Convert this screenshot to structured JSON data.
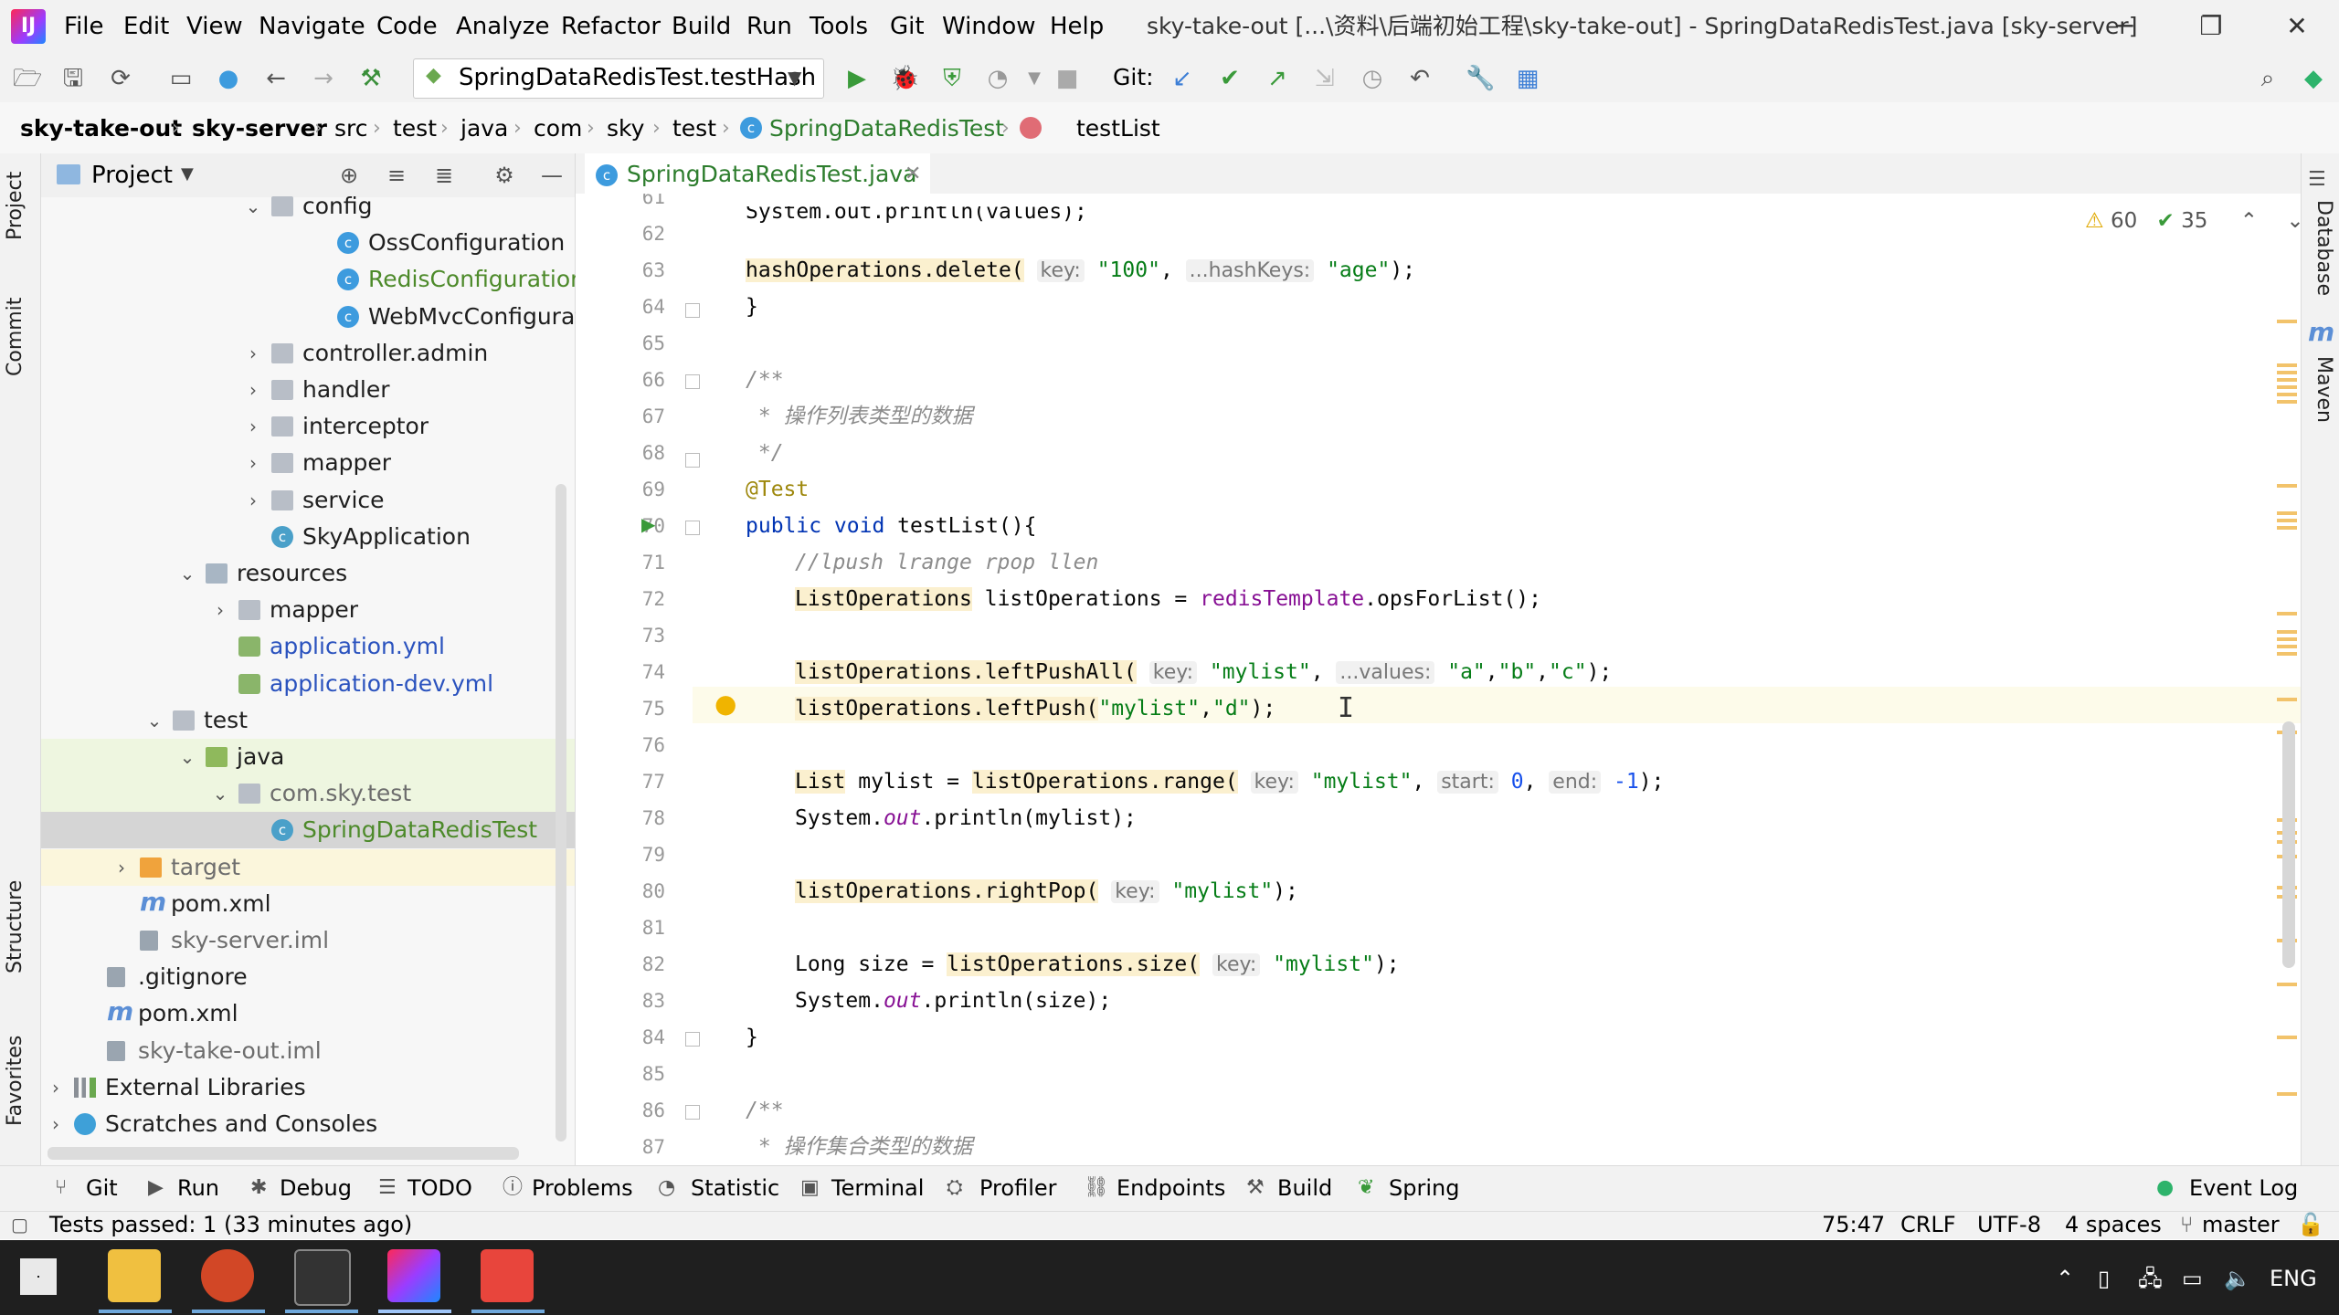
{
  "menu": [
    "File",
    "Edit",
    "View",
    "Navigate",
    "Code",
    "Analyze",
    "Refactor",
    "Build",
    "Run",
    "Tools",
    "Git",
    "Window",
    "Help"
  ],
  "window_title": "sky-take-out [...\\资料\\后端初始工程\\sky-take-out] - SpringDataRedisTest.java [sky-server]",
  "toolbar": {
    "run_config": "SpringDataRedisTest.testHash",
    "git_label": "Git:"
  },
  "breadcrumb": [
    "sky-take-out",
    "sky-server",
    "src",
    "test",
    "java",
    "com",
    "sky",
    "test",
    "SpringDataRedisTest",
    "testList"
  ],
  "left_tabs": [
    "Project",
    "Commit",
    "Structure",
    "Favorites"
  ],
  "right_tabs": [
    "Database",
    "Maven"
  ],
  "project": {
    "title": "Project",
    "tree": [
      {
        "label": "config",
        "type": "folder",
        "depth": 6,
        "arrow": "down"
      },
      {
        "label": "OssConfiguration",
        "type": "class",
        "depth": 8
      },
      {
        "label": "RedisConfiguration",
        "type": "class",
        "depth": 8
      },
      {
        "label": "WebMvcConfiguratior",
        "type": "class",
        "depth": 8
      },
      {
        "label": "controller.admin",
        "type": "folder",
        "depth": 6,
        "arrow": "right"
      },
      {
        "label": "handler",
        "type": "folder",
        "depth": 6,
        "arrow": "right"
      },
      {
        "label": "interceptor",
        "type": "folder",
        "depth": 6,
        "arrow": "right"
      },
      {
        "label": "mapper",
        "type": "folder",
        "depth": 6,
        "arrow": "right"
      },
      {
        "label": "service",
        "type": "folder",
        "depth": 6,
        "arrow": "right"
      },
      {
        "label": "SkyApplication",
        "type": "spring-class",
        "depth": 6
      },
      {
        "label": "resources",
        "type": "res-folder",
        "depth": 4,
        "arrow": "down"
      },
      {
        "label": "mapper",
        "type": "folder",
        "depth": 5,
        "arrow": "right"
      },
      {
        "label": "application.yml",
        "type": "yml",
        "depth": 5
      },
      {
        "label": "application-dev.yml",
        "type": "yml",
        "depth": 5
      },
      {
        "label": "test",
        "type": "folder",
        "depth": 3,
        "arrow": "down"
      },
      {
        "label": "java",
        "type": "green-folder",
        "depth": 4,
        "arrow": "down"
      },
      {
        "label": "com.sky.test",
        "type": "folder",
        "depth": 5,
        "arrow": "down"
      },
      {
        "label": "SpringDataRedisTest",
        "type": "spring-class",
        "depth": 6
      },
      {
        "label": "target",
        "type": "orange-folder",
        "depth": 2,
        "arrow": "right"
      },
      {
        "label": "pom.xml",
        "type": "maven",
        "depth": 2
      },
      {
        "label": "sky-server.iml",
        "type": "iml",
        "depth": 2
      },
      {
        "label": ".gitignore",
        "type": "iml",
        "depth": 1
      },
      {
        "label": "pom.xml",
        "type": "maven",
        "depth": 1
      },
      {
        "label": "sky-take-out.iml",
        "type": "iml",
        "depth": 1
      },
      {
        "label": "External Libraries",
        "type": "libs",
        "depth": 0,
        "arrow": "right"
      },
      {
        "label": "Scratches and Consoles",
        "type": "scratch",
        "depth": 0,
        "arrow": "right"
      }
    ]
  },
  "editor": {
    "tab": "SpringDataRedisTest.java",
    "inspections": {
      "warnings": "60",
      "weak_warnings": "35"
    },
    "line_numbers": [
      "61",
      "62",
      "63",
      "64",
      "65",
      "66",
      "67",
      "68",
      "69",
      "70",
      "71",
      "72",
      "73",
      "74",
      "75",
      "76",
      "77",
      "78",
      "79",
      "80",
      "81",
      "82",
      "83",
      "84",
      "85",
      "86",
      "87"
    ],
    "code": {
      "l61": "System.out.println(values);",
      "l63_call": "hashOperations.delete(",
      "l63_h1": "key:",
      "l63_s1": "\"100\"",
      "l63_h2": "...hashKeys:",
      "l63_s2": "\"age\"",
      "l64": "}",
      "l66": "/**",
      "l67": " * 操作列表类型的数据",
      "l68": " */",
      "l69": "@Test",
      "l70_kw": "public void",
      "l70": " testList(){",
      "l71": "//lpush lrange rpop llen",
      "l72_type": "ListOperations",
      "l72_mid": " listOperations = ",
      "l72_fld": "redisTemplate",
      "l72_end": ".opsForList();",
      "l74_call": "listOperations.leftPushAll(",
      "l74_h1": "key:",
      "l74_s1": "\"mylist\"",
      "l74_h2": "...values:",
      "l74_s2": "\"a\"",
      "l74_s3": "\"b\"",
      "l74_s4": "\"c\"",
      "l75_call": "listOperations.leftPush(",
      "l75_s1": "\"mylist\"",
      "l75_s2": "\"d\"",
      "l77_type": "List",
      "l77_mid": " mylist = ",
      "l77_call": "listOperations.range(",
      "l77_h1": "key:",
      "l77_s1": "\"mylist\"",
      "l77_h2": "start:",
      "l77_n1": "0",
      "l77_h3": "end:",
      "l77_n2": "-1",
      "l78_a": "System.",
      "l78_b": "out",
      "l78_c": ".println(mylist);",
      "l80_call": "listOperations.rightPop(",
      "l80_h1": "key:",
      "l80_s1": "\"mylist\"",
      "l82_a": "Long size = ",
      "l82_call": "listOperations.size(",
      "l82_h1": "key:",
      "l82_s1": "\"mylist\"",
      "l83_a": "System.",
      "l83_b": "out",
      "l83_c": ".println(size);",
      "l84": "}",
      "l86": "/**",
      "l87": " * 操作集合类型的数据"
    }
  },
  "bottom_tabs": [
    "Git",
    "Run",
    "Debug",
    "TODO",
    "Problems",
    "Statistic",
    "Terminal",
    "Profiler",
    "Endpoints",
    "Build",
    "Spring"
  ],
  "event_log": "Event Log",
  "status": {
    "message": "Tests passed: 1 (33 minutes ago)",
    "position": "75:47",
    "line_sep": "CRLF",
    "encoding": "UTF-8",
    "indent": "4 spaces",
    "branch": "master"
  },
  "taskbar": {
    "tray_lang": "ENG"
  }
}
